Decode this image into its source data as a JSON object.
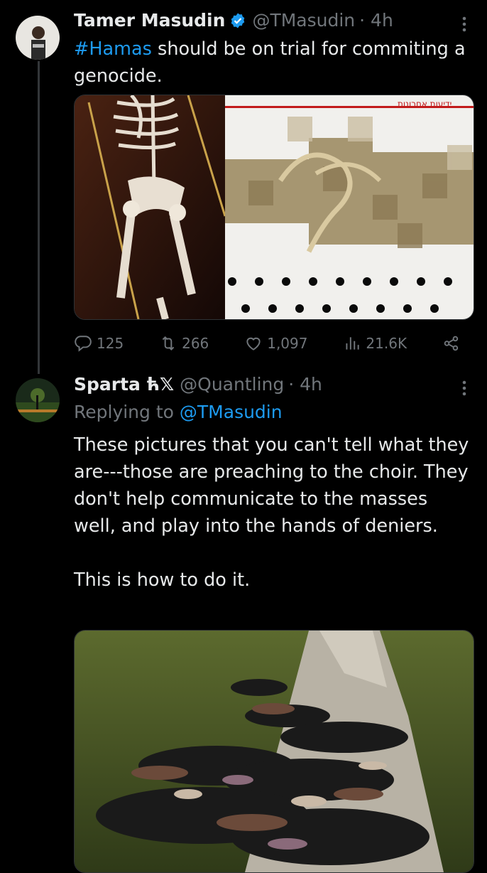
{
  "tweet1": {
    "name": "Tamer Masudin",
    "handle": "@TMasudin",
    "time": "· 4h",
    "hashtag": "#Hamas",
    "text_rest": " should be on trial for commiting a genocide.",
    "image_watermark": "ידיעות אחרונות",
    "actions": {
      "replies": "125",
      "reposts": "266",
      "likes": "1,097",
      "views": "21.6K"
    }
  },
  "tweet2": {
    "name": "Sparta ћ𝕏",
    "handle": "@Quantling",
    "time": "· 4h",
    "replying_label": "Replying to",
    "replying_handle": "@TMasudin",
    "paragraph1": "These pictures that you can't tell what they are---those are preaching to the choir. They don't help communicate to the masses well, and play into the hands of deniers.",
    "paragraph2": "This is how to do it."
  },
  "colors": {
    "background": "#000000",
    "text": "#e7e9ea",
    "muted": "#71767b",
    "accent": "#1d9bf0",
    "thread_line": "#333639"
  },
  "icons": [
    "verified-badge-icon",
    "more-icon",
    "reply-icon",
    "repost-icon",
    "like-icon",
    "views-icon",
    "share-icon"
  ]
}
